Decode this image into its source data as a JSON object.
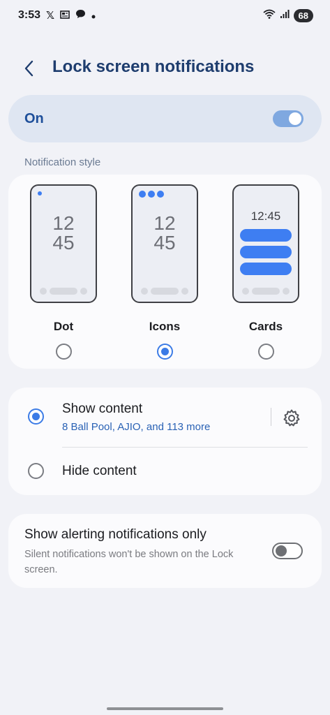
{
  "status_bar": {
    "time": "3:53",
    "left_icons": [
      "x-icon",
      "news-icon",
      "chat-icon",
      "dot-icon"
    ],
    "right_icons": [
      "wifi-icon",
      "signal-icon"
    ],
    "battery": "68"
  },
  "header": {
    "title": "Lock screen notifications"
  },
  "master": {
    "label": "On",
    "state": "on"
  },
  "notification_style": {
    "label": "Notification style",
    "options": [
      {
        "name": "Dot",
        "preview_time_h": "12",
        "preview_time_m": "45",
        "selected": false
      },
      {
        "name": "Icons",
        "preview_time_h": "12",
        "preview_time_m": "45",
        "selected": true
      },
      {
        "name": "Cards",
        "preview_time": "12:45",
        "selected": false
      }
    ]
  },
  "content": {
    "show": {
      "title": "Show content",
      "subtitle": "8 Ball Pool, AJIO, and 113 more",
      "selected": true
    },
    "hide": {
      "title": "Hide content",
      "selected": false
    }
  },
  "alerting": {
    "title": "Show alerting notifications only",
    "description": "Silent notifications won't be shown on the Lock screen.",
    "state": "off"
  },
  "colors": {
    "accent": "#3b7be6",
    "title": "#1e3d6e",
    "background": "#f1f2f7",
    "card": "#fbfbfd"
  }
}
